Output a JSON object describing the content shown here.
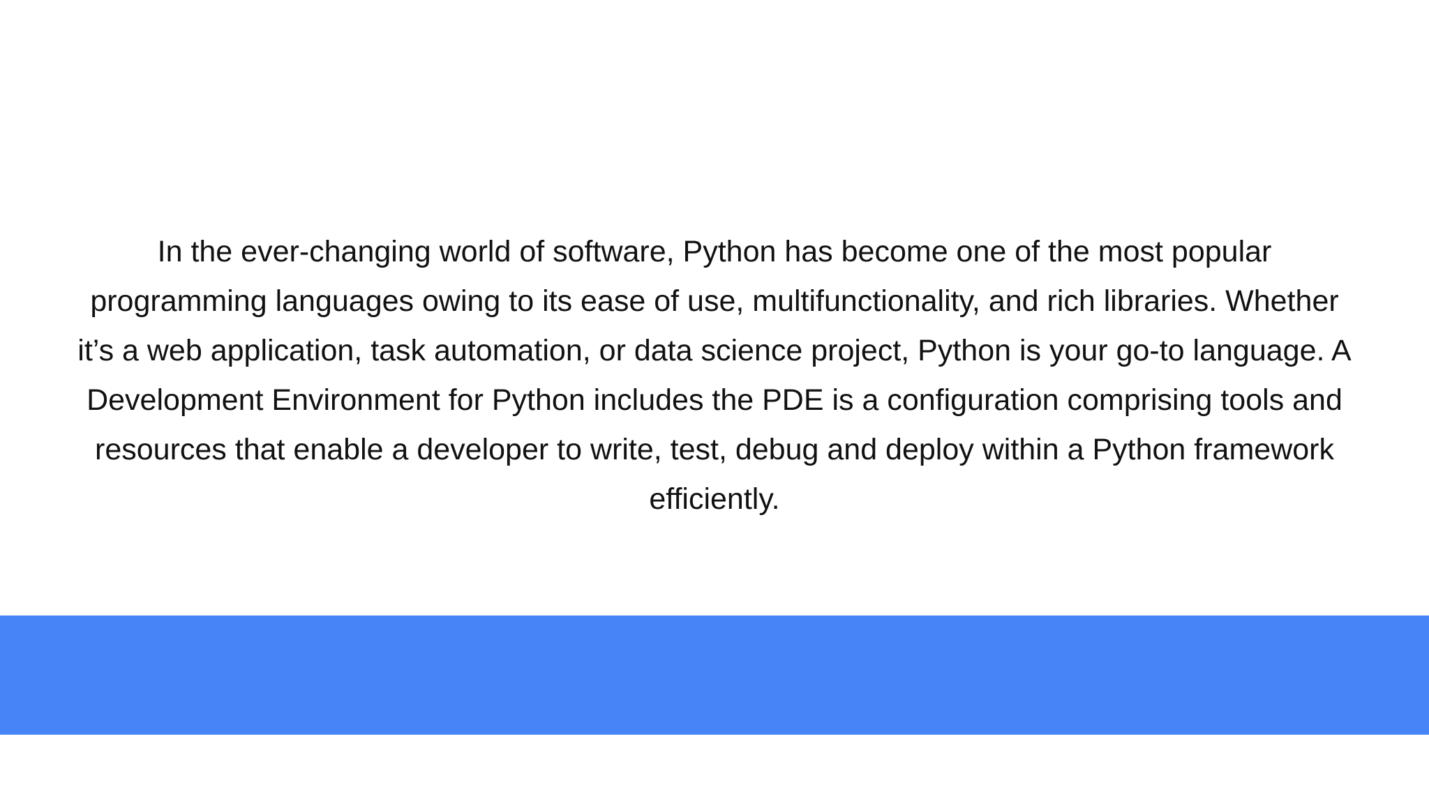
{
  "slide": {
    "paragraph_lines": [
      "In the ever-changing world of software, Python has become one of the most popular",
      "programming languages owing to its ease of use, multifunctionality, and rich libraries. Whether",
      "it’s a web application, task automation, or data science project, Python is your go-to language. A",
      "Development Environment for Python includes the PDE is a configuration comprising tools and",
      "resources that enable a developer to write, test, debug and deploy within a Python framework",
      "efficiently."
    ],
    "accent_color": "#4585f5",
    "background_color": "#ffffff"
  }
}
